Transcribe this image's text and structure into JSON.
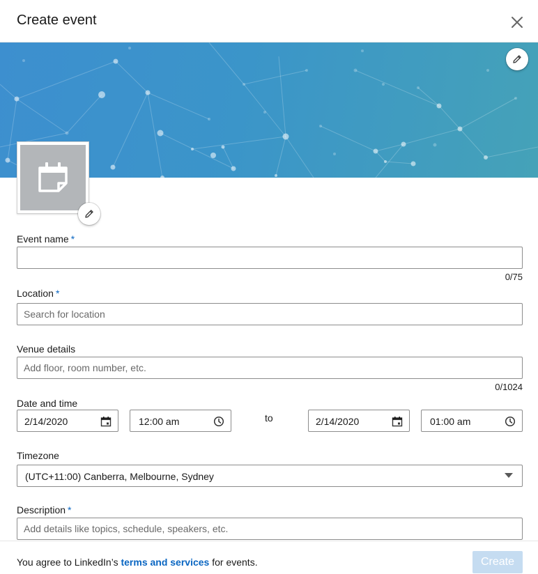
{
  "dialog": {
    "title": "Create event"
  },
  "colors": {
    "accent": "#0a66c2",
    "banner_start": "#3d8fcf",
    "banner_end": "#45a2b8",
    "create_disabled": "#c5dcf1"
  },
  "icons": {
    "close": "close-icon",
    "banner_edit": "pencil-icon",
    "logo_placeholder": "calendar-icon",
    "logo_edit": "pencil-icon",
    "date": "calendar-icon",
    "time": "clock-icon",
    "dropdown": "caret-down-icon"
  },
  "form": {
    "event_name": {
      "label": "Event name",
      "required_mark": "*",
      "value": "",
      "counter": "0/75"
    },
    "location": {
      "label": "Location",
      "required_mark": "*",
      "placeholder": "Search for location",
      "value": ""
    },
    "venue": {
      "label": "Venue details",
      "placeholder": "Add floor, room number, etc.",
      "value": "",
      "counter": "0/1024"
    },
    "datetime": {
      "label": "Date and time",
      "start_date": "2/14/2020",
      "start_time": "12:00 am",
      "separator": "to",
      "end_date": "2/14/2020",
      "end_time": "01:00 am"
    },
    "timezone": {
      "label": "Timezone",
      "value": "(UTC+11:00) Canberra, Melbourne, Sydney"
    },
    "description": {
      "label": "Description",
      "required_mark": "*",
      "placeholder": "Add details like topics, schedule, speakers, etc.",
      "value": ""
    }
  },
  "footer": {
    "agree_prefix": "You agree to LinkedIn’s",
    "terms_link": "terms and services",
    "agree_suffix": "for events.",
    "create_label": "Create"
  }
}
